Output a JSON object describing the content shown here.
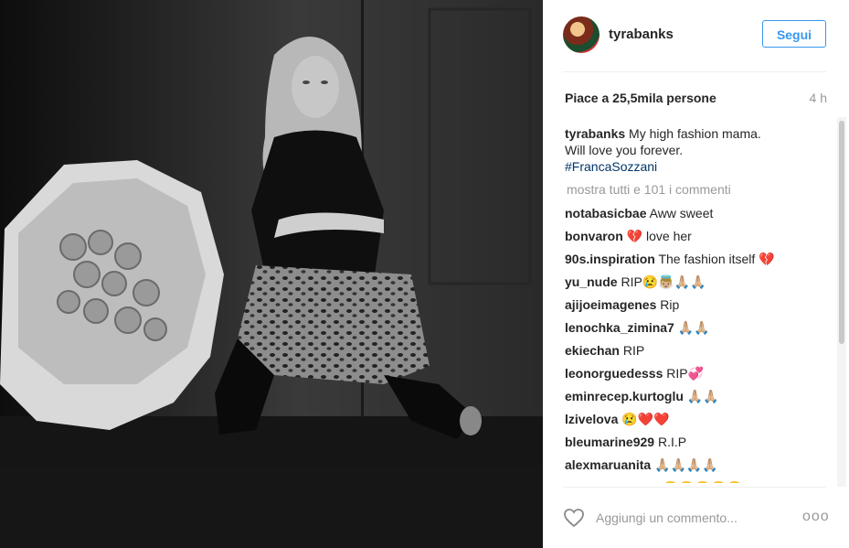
{
  "post": {
    "username": "tyrabanks",
    "follow_label": "Segui",
    "likes": "Piace a 25,5mila persone",
    "time": "4 h"
  },
  "caption": {
    "username": "tyrabanks",
    "line1": "My high fashion mama.",
    "line2": "Will love you forever.",
    "hashtag": "#FrancaSozzani"
  },
  "show_all": "mostra tutti e 101 i commenti",
  "comments": [
    {
      "user": "notabasicbae",
      "text": "Aww sweet"
    },
    {
      "user": "bonvaron",
      "text": "💔 love her"
    },
    {
      "user": "90s.inspiration",
      "text": "The fashion itself 💔"
    },
    {
      "user": "yu_nude",
      "text": "RIP😢👼🏼🙏🏼🙏🏼"
    },
    {
      "user": "ajijoeimagenes",
      "text": "Rip"
    },
    {
      "user": "lenochka_zimina7",
      "text": "🙏🏼🙏🏼"
    },
    {
      "user": "ekiechan",
      "text": "RIP"
    },
    {
      "user": "leonorguedesss",
      "text": "RIP💞"
    },
    {
      "user": "eminrecep.kurtoglu",
      "text": "🙏🏼🙏🏼"
    },
    {
      "user": "lzivelova",
      "text": "😢❤️❤️"
    },
    {
      "user": "bleumarine929",
      "text": "R.I.P"
    },
    {
      "user": "alexmaruanita",
      "text": "🙏🏼🙏🏼🙏🏼🙏🏼"
    },
    {
      "user": "iamtessaciance",
      "text": "😔😔😔😔😔"
    }
  ],
  "add_comment_placeholder": "Aggiungi un commento...",
  "more_label": "ooo",
  "icons": {
    "like": "heart-icon",
    "options": "more-options-icon"
  },
  "colors": {
    "accent": "#3897f0",
    "hashtag": "#003569",
    "muted": "#999999"
  }
}
